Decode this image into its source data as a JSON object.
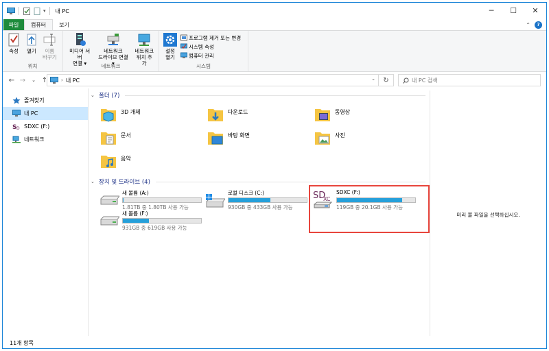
{
  "window": {
    "title": "내 PC",
    "min": "─",
    "max": "☐",
    "close": "✕"
  },
  "tabs": [
    {
      "label": "파일",
      "kind": "file"
    },
    {
      "label": "컴퓨터",
      "kind": "active"
    },
    {
      "label": "보기",
      "kind": "normal"
    }
  ],
  "tabs_right": {
    "collapse": "⌃",
    "help": "?"
  },
  "ribbon": {
    "location": {
      "label": "위치",
      "buttons": [
        {
          "label": "속성",
          "dim": false
        },
        {
          "label": "열기",
          "dim": false
        },
        {
          "label": "이름\n바꾸기",
          "dim": true
        }
      ]
    },
    "network": {
      "label": "네트워크",
      "buttons": [
        {
          "label": "미디어 서버\n연결 ▾"
        },
        {
          "label": "네트워크\n드라이브 연결 ▾"
        },
        {
          "label": "네트워크\n위치 추가"
        }
      ]
    },
    "system": {
      "label": "시스템",
      "open_settings": "설정\n열기",
      "items": [
        "프로그램 제거 또는 변경",
        "시스템 속성",
        "컴퓨터 관리"
      ]
    }
  },
  "nav": {
    "back": "←",
    "forward": "→",
    "recent": "⌄",
    "up": "↑"
  },
  "address": {
    "path": "내 PC",
    "separator": "›",
    "dropdown": "⌄",
    "refresh": "↻"
  },
  "search": {
    "placeholder": "내 PC 검색"
  },
  "sidebar": [
    {
      "label": "즐겨찾기",
      "icon": "star-icon",
      "selected": false
    },
    {
      "label": "내 PC",
      "icon": "pc-icon",
      "selected": true
    },
    {
      "label": "SDXC (F:)",
      "icon": "sd-icon",
      "selected": false
    },
    {
      "label": "네트워크",
      "icon": "network-icon",
      "selected": false
    }
  ],
  "folders_section": {
    "title": "폴더 (7)",
    "chevron": "⌄"
  },
  "folders": [
    {
      "name": "3D 개체",
      "icon": "3d-objects-folder-icon"
    },
    {
      "name": "다운로드",
      "icon": "downloads-folder-icon"
    },
    {
      "name": "동영상",
      "icon": "videos-folder-icon"
    },
    {
      "name": "문서",
      "icon": "documents-folder-icon"
    },
    {
      "name": "바탕 화면",
      "icon": "desktop-folder-icon"
    },
    {
      "name": "사진",
      "icon": "pictures-folder-icon"
    },
    {
      "name": "음악",
      "icon": "music-folder-icon"
    }
  ],
  "drives_section": {
    "title": "장치 및 드라이브 (4)",
    "chevron": "⌄"
  },
  "drives": [
    {
      "name": "새 볼륨 (A:)",
      "free": "1.81TB 중 1.80TB 사용 가능",
      "used_fraction": 0.005,
      "icon": "hdd-icon"
    },
    {
      "name": "로컬 디스크 (C:)",
      "free": "930GB 중 433GB 사용 가능",
      "used_fraction": 0.534,
      "icon": "windows-drive-icon"
    },
    {
      "name": "SDXC (F:)",
      "free": "119GB 중 20.1GB 사용 가능",
      "used_fraction": 0.831,
      "icon": "sdxc-drive-icon"
    },
    {
      "name": "새 볼륨 (F:)",
      "free": "931GB 중 619GB 사용 가능",
      "used_fraction": 0.335,
      "icon": "hdd-icon"
    }
  ],
  "sd_logo": {
    "sd": "SD",
    "xc": "XC"
  },
  "preview": {
    "message": "미리 볼 파일을 선택하십시오."
  },
  "status": {
    "items": "11개 항목"
  },
  "colors": {
    "accent": "#26a0da",
    "file_tab": "#1e8b3c",
    "selection": "#cce8ff",
    "highlight": "#e8453c"
  }
}
